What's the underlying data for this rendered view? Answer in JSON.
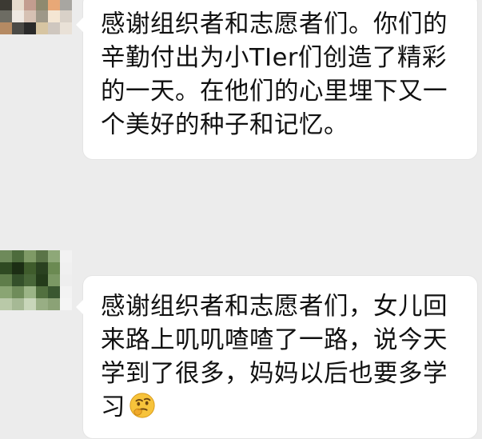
{
  "messages": [
    {
      "text": "感谢组织者和志愿者们。你们的辛勤付出为小TIer们创造了精彩的一天。在他们的心里埋下又一个美好的种子和记忆。",
      "avatar_colors": [
        "#3c3a33",
        "#e7dccd",
        "#c39d8f",
        "#8f8a6f",
        "#e8a877",
        "#a8a6a1",
        "#6d6c63",
        "#efe9e2",
        "#d6c1b3",
        "#9e9888",
        "#f4e6d3",
        "#d9d1c8",
        "#b58a63",
        "#4b4a46",
        "#2a2a2a",
        "#d7c5a2",
        "#cfc7bf",
        "#e9e1d7"
      ]
    },
    {
      "text": "感谢组织者和志愿者们，女儿回来路上叽叽喳喳了一路，说今天学到了很多，妈妈以后也要多学习",
      "emoji": "thinking-face-emoji",
      "avatar_colors": [
        "#6e8a5a",
        "#4d6b3c",
        "#7f9a66",
        "#5a7447",
        "#8ea878",
        "#f2f2f2",
        "#2f4a22",
        "#1c2e14",
        "#3f5c2c",
        "#2a4120",
        "#6b8a52",
        "#f0f0f0",
        "#5f7d4a",
        "#34502a",
        "#486638",
        "#243b1a",
        "#7b9864",
        "#eeeeee",
        "#8aa573",
        "#6f8c5a",
        "#9bb486",
        "#52703f",
        "#3a5730",
        "#f3f3f3",
        "#b9c9a8",
        "#a6b995",
        "#c8d6ba",
        "#98ae84",
        "#8ba276",
        "#f5f5f5"
      ]
    }
  ],
  "colors": {
    "background": "#ececec",
    "bubble": "#ffffff",
    "text": "#111111"
  }
}
